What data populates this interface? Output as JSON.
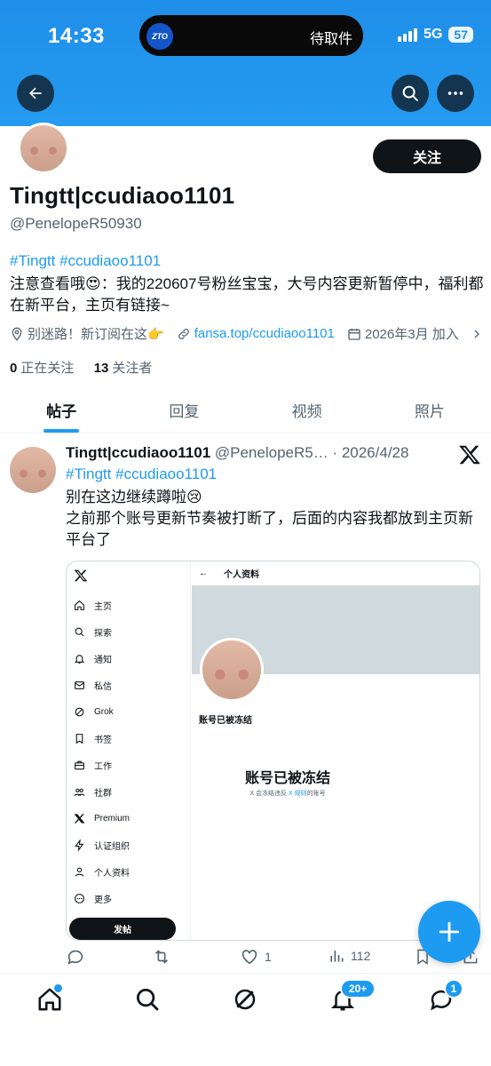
{
  "status_bar": {
    "time": "14:33",
    "island_logo": "ZTO",
    "island_text": "待取件",
    "network": "5G",
    "battery": "57"
  },
  "profile": {
    "follow_label": "关注",
    "name": "Tingtt|ccudiaoo1101",
    "handle": "@PenelopeR50930",
    "bio_tags": "#Tingtt #ccudiaoo1101",
    "bio_text": "注意查看哦😍：我的220607号粉丝宝宝，大号内容更新暂停中，福利都在新平台，主页有链接~",
    "location": "别迷路！新订阅在这👉",
    "link": "fansa.top/ccudiaoo1101",
    "joined": "2026年3月 加入",
    "following_count": "0",
    "following_label": "正在关注",
    "followers_count": "13",
    "followers_label": "关注者"
  },
  "tabs": [
    "帖子",
    "回复",
    "视频",
    "照片"
  ],
  "post": {
    "name": "Tingtt|ccudiaoo1101",
    "handle_date": " @PenelopeR5… · 2026/4/28",
    "tags": "#Tingtt #ccudiaoo1101",
    "line1": "别在这边继续蹲啦😢",
    "line2": "之前那个账号更新节奏被打断了，后面的内容我都放到主页新平台了",
    "card": {
      "menu": [
        "主页",
        "探索",
        "通知",
        "私信",
        "Grok",
        "书签",
        "工作",
        "社群",
        "Premium",
        "认证组织",
        "个人资料",
        "更多"
      ],
      "post_button": "发帖",
      "header": "个人资料",
      "frozen_small": "账号已被冻结",
      "frozen_title": "账号已被冻结",
      "frozen_desc_a": "X 会冻结违反 ",
      "frozen_desc_link": "X 规则",
      "frozen_desc_b": "的账号"
    },
    "likes": "1",
    "views": "112"
  },
  "bottom_nav": {
    "notifications_badge": "20+",
    "messages_badge": "1"
  },
  "colors": {
    "accent": "#1d9bf0",
    "banner": "#1f8ee8",
    "text": "#0f1419",
    "muted": "#536471"
  }
}
